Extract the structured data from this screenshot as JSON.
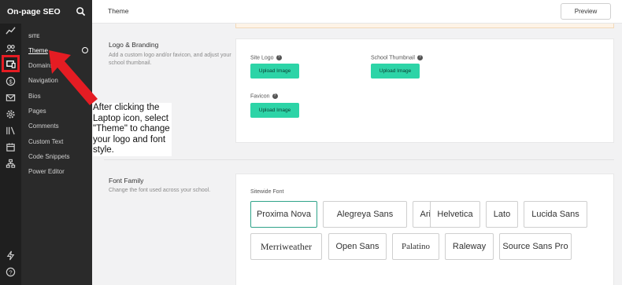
{
  "app": {
    "school_name": "On-page SEO"
  },
  "rail": {
    "icons": [
      "analytics-icon",
      "users-icon",
      "laptop-icon",
      "dollar-icon",
      "mail-icon",
      "settings-icon",
      "library-icon",
      "calendar-icon",
      "sitemap-icon",
      "bolt-icon",
      "help-icon"
    ]
  },
  "sidebar": {
    "section": "SITE",
    "items": [
      {
        "label": "Theme"
      },
      {
        "label": "Domains"
      },
      {
        "label": "Navigation"
      },
      {
        "label": "Bios"
      },
      {
        "label": "Pages"
      },
      {
        "label": "Comments"
      },
      {
        "label": "Custom Text"
      },
      {
        "label": "Code Snippets"
      },
      {
        "label": "Power Editor"
      }
    ]
  },
  "annotation": "After clicking the Laptop icon, select \"Theme\" to change your logo and font style.",
  "header": {
    "title": "Theme",
    "preview_label": "Preview"
  },
  "logo_section": {
    "title": "Logo & Branding",
    "description": "Add a custom logo and/or favicon, and adjust your school thumbnail.",
    "fields": [
      {
        "label": "Site Logo",
        "button": "Upload Image"
      },
      {
        "label": "School Thumbnail",
        "button": "Upload Image"
      },
      {
        "label": "Favicon",
        "button": "Upload Image"
      }
    ]
  },
  "font_section": {
    "title": "Font Family",
    "description": "Change the font used across your school.",
    "label": "Sitewide Font",
    "fonts": [
      "Proxima Nova",
      "Alegreya Sans",
      "Arial",
      "Helvetica",
      "Lato",
      "Lucida Sans",
      "Merriweather",
      "Open Sans",
      "Palatino",
      "Raleway",
      "Source Sans Pro"
    ],
    "selected": "Proxima Nova"
  },
  "colors": {
    "accent": "#2dd4a7",
    "highlight": "#e51c23",
    "selected_border": "#2fa389"
  }
}
